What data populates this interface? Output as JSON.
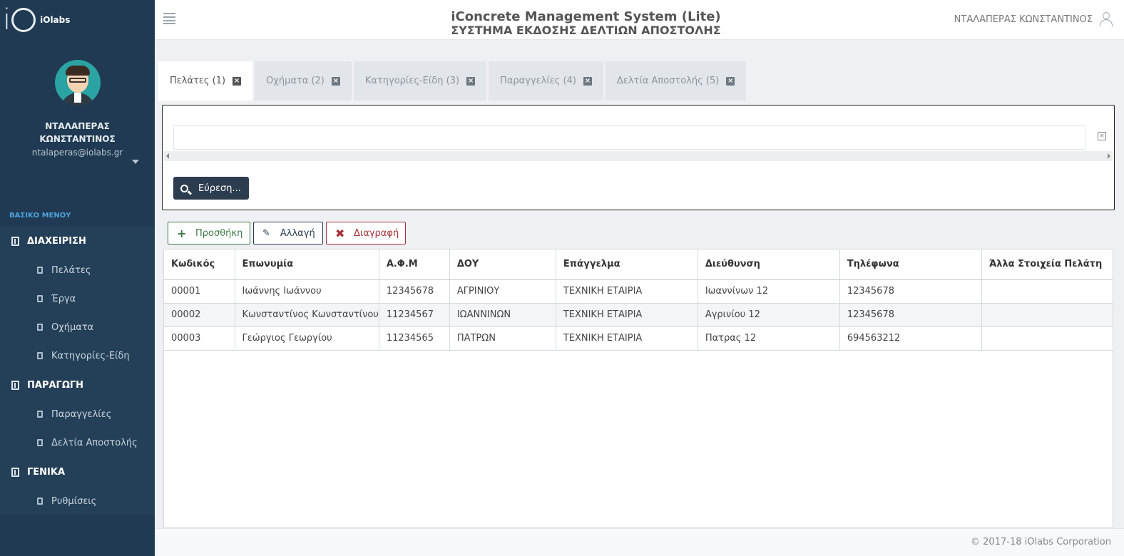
{
  "sidebar": {
    "logo": "iOlabs",
    "user_name": "ΝΤΑΛΑΠΕΡΑΣ ΚΩΝΣΤΑΝΤΙΝΟΣ",
    "user_email": "ntalaperas@iolabs.gr",
    "menu_heading": "ΒΑΣΙΚΟ ΜΕΝΟΥ",
    "groups": [
      {
        "label": "ΔΙΑΧΕΙΡΙΣΗ",
        "items": [
          "Πελάτες",
          "Έργα",
          "Οχήματα",
          "Κατηγορίες-Είδη"
        ]
      },
      {
        "label": "ΠΑΡΑΓΩΓΗ",
        "items": [
          "Παραγγελίες",
          "Δελτία Αποστολής"
        ]
      },
      {
        "label": "ΓΕΝΙΚΑ",
        "items": [
          "Ρυθμίσεις"
        ]
      }
    ]
  },
  "header": {
    "title": "iConcrete Management System (Lite)",
    "subtitle": "ΣΥΣΤΗΜΑ ΕΚΔΟΣΗΣ ΔΕΛΤΙΩΝ ΑΠΟΣΤΟΛΗΣ",
    "user": "ΝΤΑΛΑΠΕΡΑΣ ΚΩΝΣΤΑΝΤΙΝΟΣ"
  },
  "tabs": [
    {
      "label": "Πελάτες (1)",
      "active": true
    },
    {
      "label": "Οχήματα (2)",
      "active": false
    },
    {
      "label": "Κατηγορίες-Είδη (3)",
      "active": false
    },
    {
      "label": "Παραγγελίες (4)",
      "active": false
    },
    {
      "label": "Δελτία Αποστολής (5)",
      "active": false
    }
  ],
  "search": {
    "value": "",
    "button_label": "Εύρεση..."
  },
  "actions": {
    "add": "Προσθήκη",
    "edit": "Αλλαγή",
    "delete": "Διαγραφή"
  },
  "table": {
    "columns": [
      "Κωδικός",
      "Επωνυμία",
      "Α.Φ.Μ",
      "ΔΟΥ",
      "Επάγγελμα",
      "Διεύθυνση",
      "Τηλέφωνα",
      "Άλλα Στοιχεία Πελάτη"
    ],
    "rows": [
      [
        "00001",
        "Ιωάννης Ιωάννου",
        "12345678",
        "ΑΓΡΙΝΙΟΥ",
        "ΤΕΧΝΙΚΗ ΕΤΑΙΡΙΑ",
        "Ιωαννίνων 12",
        "12345678",
        ""
      ],
      [
        "00002",
        "Κωνσταντίνος Κωνσταντίνου",
        "11234567",
        "ΙΩΑΝΝΙΝΩΝ",
        "ΤΕΧΝΙΚΗ ΕΤΑΙΡΙΑ",
        "Αγρινίου 12",
        "12345678",
        ""
      ],
      [
        "00003",
        "Γεώργιος Γεωργίου",
        "11234565",
        "ΠΑΤΡΩΝ",
        "ΤΕΧΝΙΚΗ ΕΤΑΙΡΙΑ",
        "Πατρας 12",
        "694563212",
        ""
      ]
    ]
  },
  "footer": "© 2017-18 iOlabs Corporation"
}
